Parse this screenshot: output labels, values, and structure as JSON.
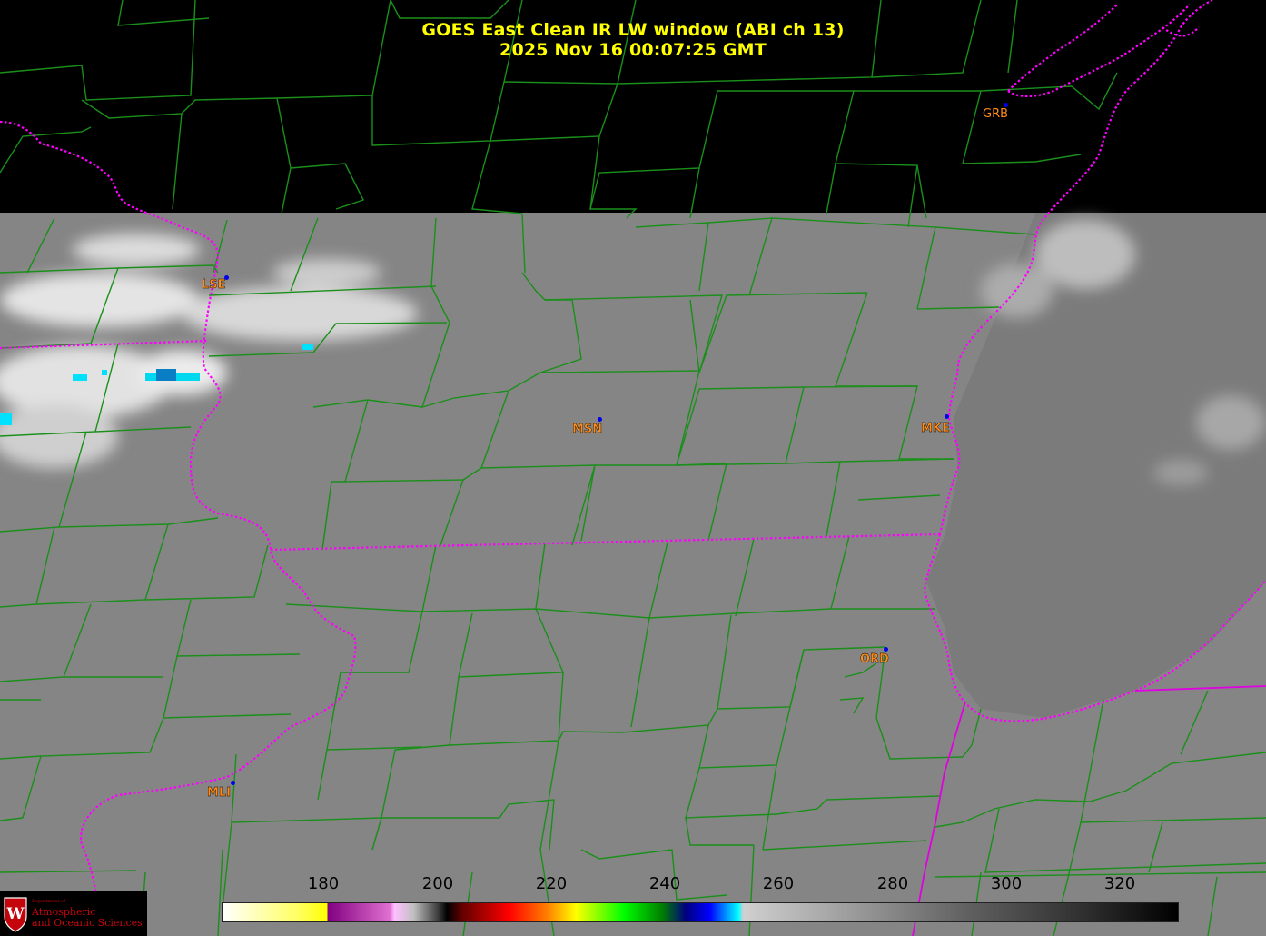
{
  "header": {
    "title_line1": "GOES East Clean IR LW window (ABI ch 13)",
    "title_line2": "2025 Nov 16  00:07:25 GMT"
  },
  "stations": [
    {
      "id": "LSE",
      "color": "#ff8c1a"
    },
    {
      "id": "MSN",
      "color": "#ff8c1a"
    },
    {
      "id": "MKE",
      "color": "#ff8c1a"
    },
    {
      "id": "GRB",
      "color": "#ff8c1a"
    },
    {
      "id": "ORD",
      "color": "#ff8c1a"
    },
    {
      "id": "MLI",
      "color": "#ff8c1a"
    }
  ],
  "colorbar": {
    "ticks": [
      "180",
      "200",
      "220",
      "240",
      "260",
      "280",
      "300",
      "320"
    ],
    "range": [
      163,
      330
    ],
    "colors": {
      "warm_end": "#ffffff",
      "yellow": "#ffff00",
      "magenta": "#800080",
      "red": "#ff0000",
      "green": "#00ff00",
      "blue": "#000080",
      "cyan": "#00ffff",
      "cold_gray": "#c0c0c0",
      "black": "#000000"
    }
  },
  "overlays": {
    "county_line_color": "#1a8f1a",
    "state_line_color": "#ff00ff",
    "scene_gray": "#808080",
    "no_data_color": "#000000"
  },
  "logo": {
    "line1": "Department of",
    "line2": "Atmospheric",
    "line3": "and Oceanic Sciences"
  }
}
